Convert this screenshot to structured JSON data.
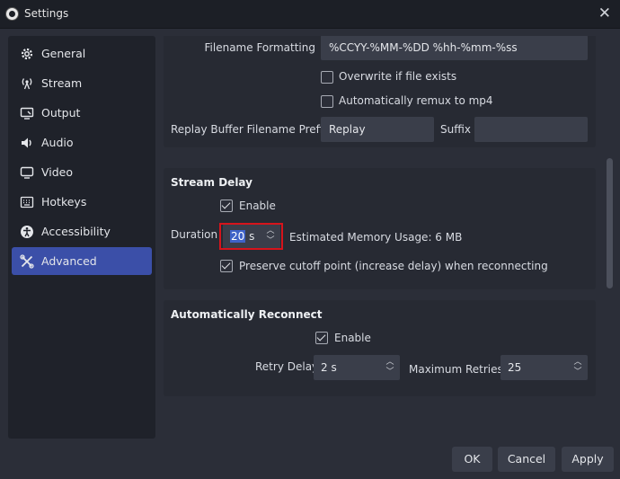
{
  "window": {
    "title": "Settings"
  },
  "sidebar": {
    "items": [
      {
        "label": "General",
        "icon": "gear-icon"
      },
      {
        "label": "Stream",
        "icon": "antenna-icon"
      },
      {
        "label": "Output",
        "icon": "monitor-output-icon"
      },
      {
        "label": "Audio",
        "icon": "speaker-icon"
      },
      {
        "label": "Video",
        "icon": "display-icon"
      },
      {
        "label": "Hotkeys",
        "icon": "keyboard-icon"
      },
      {
        "label": "Accessibility",
        "icon": "accessibility-icon"
      },
      {
        "label": "Advanced",
        "icon": "tools-icon",
        "active": true
      }
    ]
  },
  "recording": {
    "filename_formatting_label": "Filename Formatting",
    "filename_formatting_value": "%CCYY-%MM-%DD %hh-%mm-%ss",
    "overwrite_label": "Overwrite if file exists",
    "overwrite_checked": false,
    "remux_label": "Automatically remux to mp4",
    "remux_checked": false,
    "replay_prefix_label": "Replay Buffer Filename Prefix",
    "replay_prefix_value": "Replay",
    "suffix_label": "Suffix",
    "suffix_value": ""
  },
  "stream_delay": {
    "title": "Stream Delay",
    "enable_label": "Enable",
    "enable_checked": true,
    "duration_label": "Duration",
    "duration_number": "20",
    "duration_unit": " s",
    "memory_label": "Estimated Memory Usage: 6 MB",
    "preserve_label": "Preserve cutoff point (increase delay) when reconnecting",
    "preserve_checked": true
  },
  "reconnect": {
    "title": "Automatically Reconnect",
    "enable_label": "Enable",
    "enable_checked": true,
    "retry_delay_label": "Retry Delay",
    "retry_delay_value": "2 s",
    "max_retries_label": "Maximum Retries",
    "max_retries_value": "25"
  },
  "footer": {
    "ok_label": "OK",
    "cancel_label": "Cancel",
    "apply_label": "Apply"
  },
  "colors": {
    "accent": "#3b4fa8",
    "highlight_border": "#d6141c",
    "selection": "#3f62c8"
  }
}
